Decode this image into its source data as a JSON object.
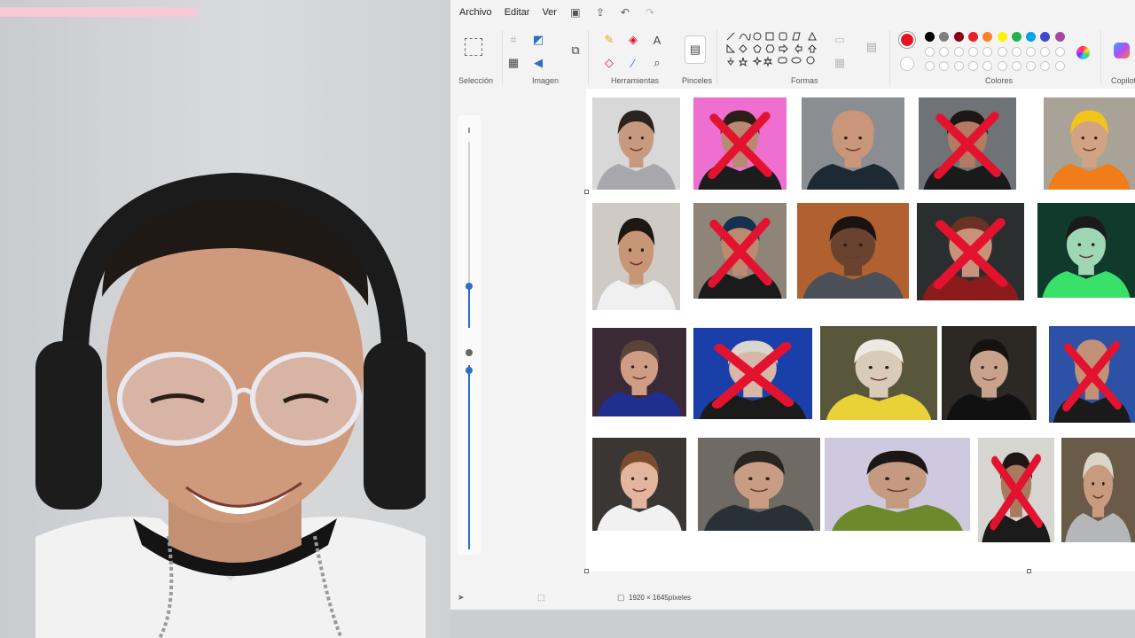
{
  "menu": {
    "file": "Archivo",
    "edit": "Editar",
    "view": "Ver"
  },
  "ribbon": {
    "groups": {
      "selection": "Selección",
      "image": "Imagen",
      "tools": "Herramientas",
      "brushes": "Pinceles",
      "shapes": "Formas",
      "colors": "Colores",
      "copilot": "Copilot"
    },
    "tool_text": "A",
    "active_color": "#e81123",
    "palette_row1": [
      "#000000",
      "#7f7f7f",
      "#880015",
      "#ed1c24",
      "#ff7f27",
      "#fff200",
      "#22b14c",
      "#00a2e8",
      "#3f48cc",
      "#a349a4"
    ],
    "palette_row2": [
      "#ffffff",
      "#c3c3c3",
      "#b97a57",
      "#ffaec9",
      "#ffc90e",
      "#efe4b0",
      "#b5e61d",
      "#99d9ea",
      "#7092be",
      "#c8bfe7"
    ]
  },
  "status": {
    "dimensions": "1920 × 1645píxeles"
  },
  "photos": {
    "row1": [
      {
        "name": "hoodie-boy",
        "crossed": false,
        "bg": "#d8d8d8",
        "skin": "#c79a80",
        "hair": "#2a2320",
        "shirt": "#a8a8ac"
      },
      {
        "name": "pink-bg-man",
        "crossed": true,
        "bg": "#ef6fd1",
        "skin": "#b98a72",
        "hair": "#2b1e18",
        "shirt": "#1c1c1c"
      },
      {
        "name": "bald-smiling-man",
        "crossed": false,
        "bg": "#8a8d91",
        "skin": "#c9967a",
        "hair": "#c9967a",
        "shirt": "#1d2a33"
      },
      {
        "name": "bearded-man",
        "crossed": true,
        "bg": "#6f7276",
        "skin": "#b27c62",
        "hair": "#1d1714",
        "shirt": "#1a1a1a"
      },
      {
        "name": "construction-guy",
        "crossed": false,
        "bg": "#a9a296",
        "skin": "#d1a283",
        "hair": "#f3c51c",
        "shirt": "#f07c1a"
      }
    ],
    "row2": [
      {
        "name": "boy-white-shirt",
        "crossed": false,
        "bg": "#cfcac3",
        "skin": "#c79677",
        "hair": "#1e1814",
        "shirt": "#f0f0f0"
      },
      {
        "name": "cap-man",
        "crossed": true,
        "bg": "#8e8478",
        "skin": "#bb8a6f",
        "hair": "#15314f",
        "shirt": "#1b1b1b"
      },
      {
        "name": "headset-man",
        "crossed": false,
        "bg": "#b0612f",
        "skin": "#6a4330",
        "hair": "#1b1310",
        "shirt": "#4b5058"
      },
      {
        "name": "gaming-chair-man",
        "crossed": true,
        "bg": "#2a2e2e",
        "skin": "#c8917a",
        "hair": "#6a3222",
        "shirt": "#8b1b1b"
      },
      {
        "name": "green-glow-man",
        "crossed": false,
        "bg": "#0f3a2c",
        "skin": "#9fd6b3",
        "hair": "#1a1a1a",
        "shirt": "#39e06a"
      }
    ],
    "row3": [
      {
        "name": "glasses-man",
        "crossed": false,
        "bg": "#3a2a35",
        "skin": "#cf9d86",
        "hair": "#5b4437",
        "shirt": "#1e2f8f"
      },
      {
        "name": "blue-studio-man",
        "crossed": true,
        "bg": "#1b3fa8",
        "skin": "#d7b7a6",
        "hair": "#d9d5cf",
        "shirt": "#1b1b1b"
      },
      {
        "name": "white-hair-figure",
        "crossed": false,
        "bg": "#58573c",
        "skin": "#d8cbb8",
        "hair": "#eeeae3",
        "shirt": "#e8d237"
      },
      {
        "name": "dark-room-boy",
        "crossed": false,
        "bg": "#2c2823",
        "skin": "#c8a28c",
        "hair": "#151210",
        "shirt": "#111111"
      },
      {
        "name": "bald-man-blue",
        "crossed": true,
        "bg": "#2d52a5",
        "skin": "#c19278",
        "hair": "#c19278",
        "shirt": "#1a1a1a"
      }
    ],
    "row4": [
      {
        "name": "headset-boy",
        "crossed": false,
        "bg": "#3a3634",
        "skin": "#e3b49e",
        "hair": "#7b4b2c",
        "shirt": "#f1f1f1"
      },
      {
        "name": "chair-man",
        "crossed": false,
        "bg": "#6f6a63",
        "skin": "#c99d84",
        "hair": "#2a2420",
        "shirt": "#2a3136"
      },
      {
        "name": "headphones-boy",
        "crossed": false,
        "bg": "#cfc9df",
        "skin": "#c49a80",
        "hair": "#1c1714",
        "shirt": "#6c8a2c"
      },
      {
        "name": "curly-hair-boy",
        "crossed": true,
        "bg": "#d7d5d0",
        "skin": "#a87a60",
        "hair": "#1c1714",
        "shirt": "#1b1b1b"
      },
      {
        "name": "cap-gray-shirt",
        "crossed": false,
        "bg": "#6a5a48",
        "skin": "#c89a7e",
        "hair": "#d9d5c7",
        "shirt": "#b4b6ba"
      }
    ]
  }
}
